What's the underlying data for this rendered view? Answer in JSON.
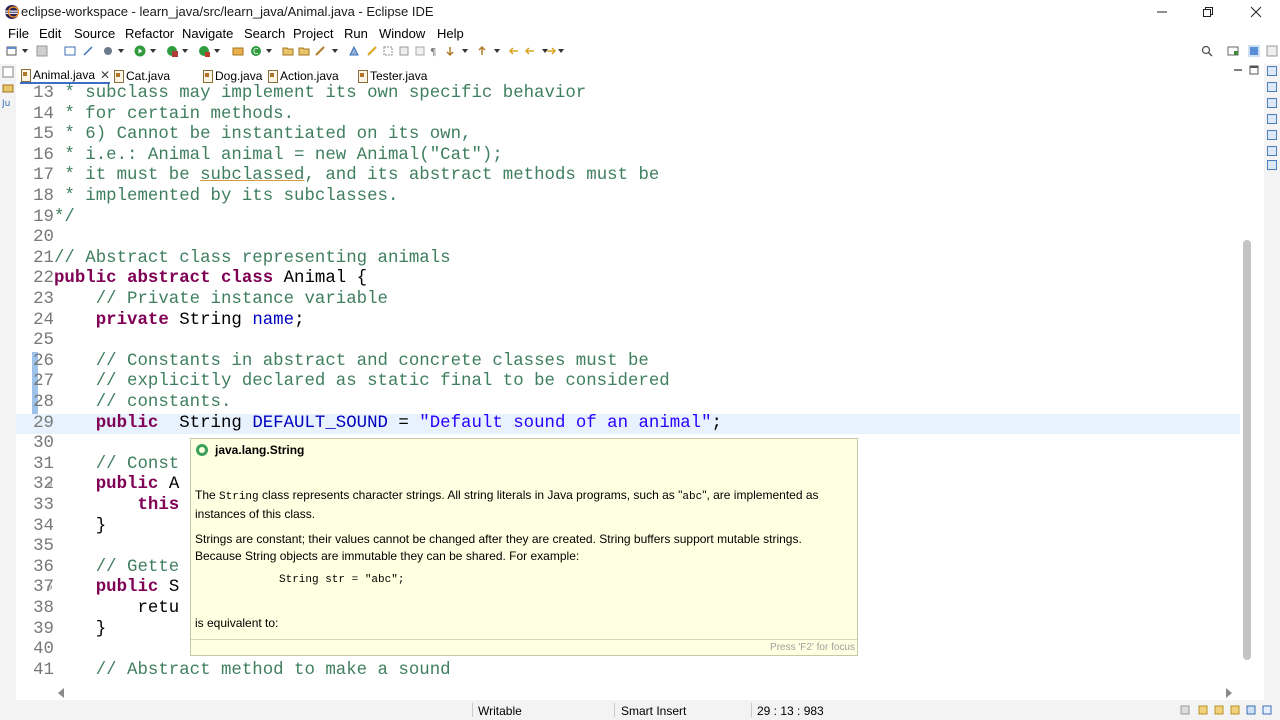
{
  "window": {
    "title": "eclipse-workspace - learn_java/src/learn_java/Animal.java - Eclipse IDE",
    "minimize_icon": "minimize-icon",
    "restore_icon": "restore-icon",
    "close_icon": "close-icon"
  },
  "menu": [
    "File",
    "Edit",
    "Source",
    "Refactor",
    "Navigate",
    "Search",
    "Project",
    "Run",
    "Window",
    "Help"
  ],
  "tabs": [
    {
      "label": "Animal.java",
      "active": true,
      "close": "✕"
    },
    {
      "label": "Cat.java",
      "active": false
    },
    {
      "label": "Dog.java",
      "active": false
    },
    {
      "label": "Action.java",
      "active": false
    },
    {
      "label": "Tester.java",
      "active": false
    }
  ],
  "editor": {
    "lines": [
      {
        "n": "13",
        "code": " * subclass may implement its own specific behavior"
      },
      {
        "n": "14",
        "code": " * for certain methods."
      },
      {
        "n": "15",
        "code": " * 6) Cannot be instantiated on its own,"
      },
      {
        "n": "16",
        "code": " * i.e.: Animal animal = new Animal(\"Cat\");"
      },
      {
        "n": "17",
        "code": " * it must be subclassed, and its abstract methods must be"
      },
      {
        "n": "18",
        "code": " * implemented by its subclasses."
      },
      {
        "n": "19",
        "code": "*/"
      },
      {
        "n": "20",
        "code": ""
      },
      {
        "n": "21",
        "code": "// Abstract class representing animals"
      },
      {
        "n": "22",
        "code": "public abstract class Animal {"
      },
      {
        "n": "23",
        "code": "    // Private instance variable"
      },
      {
        "n": "24",
        "code": "    private String name;"
      },
      {
        "n": "25",
        "code": ""
      },
      {
        "n": "26",
        "code": "    // Constants in abstract and concrete classes must be"
      },
      {
        "n": "27",
        "code": "    // explicitly declared as static final to be considered"
      },
      {
        "n": "28",
        "code": "    // constants."
      },
      {
        "n": "29",
        "code": "    public  String DEFAULT_SOUND = \"Default sound of an animal\";"
      },
      {
        "n": "30",
        "code": ""
      },
      {
        "n": "31",
        "code": "    // Const"
      },
      {
        "n": "32",
        "code": "    public A"
      },
      {
        "n": "33",
        "code": "        this"
      },
      {
        "n": "34",
        "code": "    }"
      },
      {
        "n": "35",
        "code": ""
      },
      {
        "n": "36",
        "code": "    // Gette"
      },
      {
        "n": "37",
        "code": "    public S"
      },
      {
        "n": "38",
        "code": "        retu"
      },
      {
        "n": "39",
        "code": "    }"
      },
      {
        "n": "40",
        "code": ""
      },
      {
        "n": "41",
        "code": "    // Abstract method to make a sound"
      }
    ],
    "current_line": "29",
    "fold_marker": "⊖"
  },
  "hover": {
    "title": "java.lang.String",
    "p1_pre": "The ",
    "p1_code1": "String",
    "p1_mid": " class represents character strings. All string literals in Java programs, such as \"",
    "p1_code2": "abc",
    "p1_post": "\", are implemented as instances of this class.",
    "p2": "Strings are constant; their values cannot be changed after they are created. String buffers support mutable strings. Because String objects are immutable they can be shared. For example:",
    "code": "String str = \"abc\";",
    "p3": "is equivalent to:",
    "footer": "Press 'F2' for focus"
  },
  "status": {
    "writable": "Writable",
    "insert_mode": "Smart Insert",
    "position": "29 : 13 : 983"
  },
  "colors": {
    "keyword": "#7f0055",
    "comment": "#3f7f5f",
    "string": "#2a00ff",
    "field": "#0000c0",
    "current_line": "#e8f2fe",
    "hover_bg": "#ffffe1"
  }
}
